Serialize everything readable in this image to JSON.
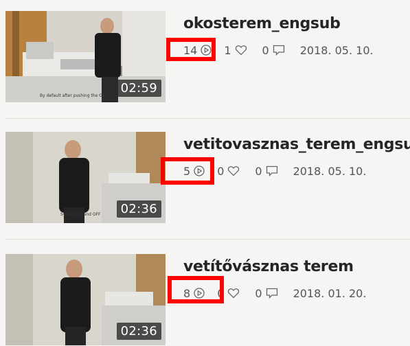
{
  "videos": [
    {
      "title": "okosterem_engsub",
      "duration": "02:59",
      "plays": "14",
      "likes": "1",
      "comments": "0",
      "date": "2018. 05. 10.",
      "thumbnail_caption": "By default after pushing the ON"
    },
    {
      "title": "vetitovasznas_terem_engsub",
      "duration": "02:36",
      "plays": "5",
      "likes": "0",
      "comments": "0",
      "date": "2018. 05. 10.",
      "thumbnail_caption": "System on and OFF"
    },
    {
      "title": "vetítővásznas terem",
      "duration": "02:36",
      "plays": "8",
      "likes": "0",
      "comments": "0",
      "date": "2018. 01. 20.",
      "thumbnail_caption": ""
    }
  ],
  "icons": {
    "plays": "play-circle-icon",
    "likes": "heart-icon",
    "comments": "comment-icon"
  },
  "colors": {
    "highlight": "#ff0000",
    "background": "#f6f5f3",
    "duration_badge": "#2d2d2d"
  }
}
